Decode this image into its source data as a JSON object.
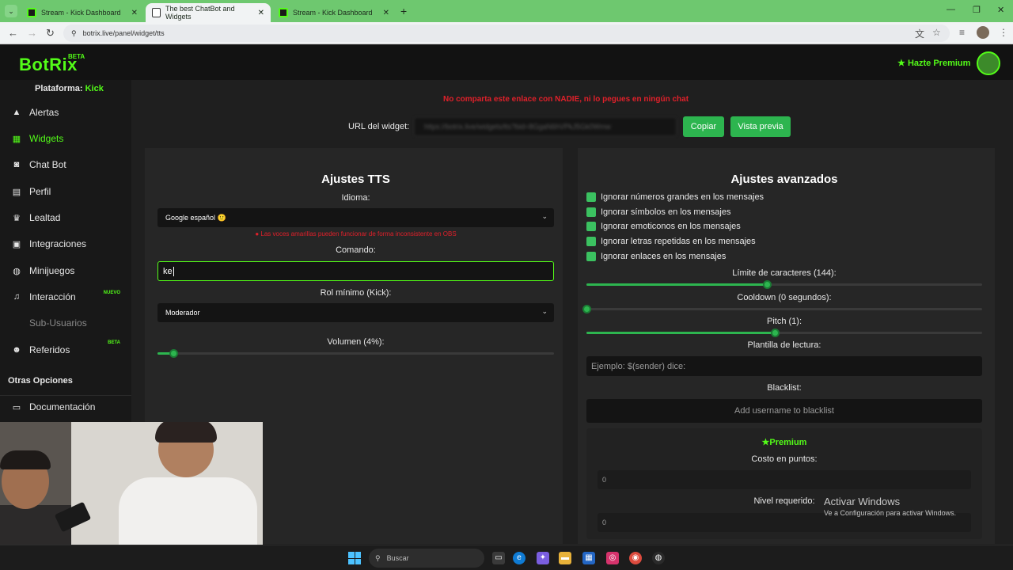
{
  "browser": {
    "tabs": [
      {
        "title": "Stream - Kick Dashboard",
        "active": false
      },
      {
        "title": "The best ChatBot and Widgets",
        "active": true
      },
      {
        "title": "Stream - Kick Dashboard",
        "active": false
      }
    ],
    "url": "botrix.live/panel/widget/tts"
  },
  "header": {
    "logo": "BotRix",
    "logo_badge": "BETA",
    "premium_link": "Hazte Premium"
  },
  "sidebar": {
    "platform_label": "Plataforma:",
    "platform_value": "Kick",
    "items": [
      {
        "label": "Alertas",
        "icon": "warning-icon"
      },
      {
        "label": "Widgets",
        "icon": "grid-icon",
        "active": true
      },
      {
        "label": "Chat Bot",
        "icon": "robot-icon"
      },
      {
        "label": "Perfil",
        "icon": "id-card-icon"
      },
      {
        "label": "Lealtad",
        "icon": "trophy-icon"
      },
      {
        "label": "Integraciones",
        "icon": "plug-icon"
      },
      {
        "label": "Minijuegos",
        "icon": "gamepad-icon"
      },
      {
        "label": "Interacción",
        "icon": "music-icon",
        "badge": "NUEVO"
      },
      {
        "label": "Sub-Usuarios",
        "icon": "users-icon",
        "disabled": true
      },
      {
        "label": "Referidos",
        "icon": "user-group-icon",
        "badge": "BETA"
      }
    ],
    "other_title": "Otras Opciones",
    "docs_label": "Documentación"
  },
  "widget": {
    "warning": "No comparta este enlace con NADIE, ni lo pegues en ningún chat",
    "url_label": "URL del widget:",
    "url_value": "https://botrix.live/widgets/tts?bid=8GgaN6hVPkJ5Gk0Wmw",
    "copy_button": "Copiar",
    "preview_button": "Vista previa"
  },
  "tts": {
    "title": "Ajustes TTS",
    "language_label": "Idioma:",
    "language_value": "Google español 🙂",
    "voice_warning": "Las voces amarillas pueden funcionar de forma inconsistente en OBS",
    "command_label": "Comando:",
    "command_value": "ke",
    "role_label": "Rol mínimo (Kick):",
    "role_value": "Moderador",
    "volume_label": "Volumen (4%):",
    "volume_fraction": 0.04
  },
  "advanced": {
    "title": "Ajustes avanzados",
    "checks": [
      "Ignorar números grandes en los mensajes",
      "Ignorar símbolos en los mensajes",
      "Ignorar emoticonos en los mensajes",
      "Ignorar letras repetidas en los mensajes",
      "Ignorar enlaces en los mensajes"
    ],
    "char_limit_label": "Límite de caracteres (144):",
    "char_limit_fraction": 0.455,
    "cooldown_label": "Cooldown (0 segundos):",
    "cooldown_fraction": 0,
    "pitch_label": "Pitch (1):",
    "pitch_fraction": 0.475,
    "template_label": "Plantilla de lectura:",
    "template_placeholder": "Ejemplo: $(sender) dice:",
    "blacklist_label": "Blacklist:",
    "blacklist_placeholder": "Add username to blacklist",
    "premium_title": "Premium",
    "cost_label": "Costo en puntos:",
    "cost_value": "0",
    "level_label": "Nivel requerido:",
    "level_value": "0"
  },
  "windows": {
    "watermark_title": "Activar Windows",
    "watermark_sub": "Ve a Configuración para activar Windows.",
    "taskbar_search": "Buscar"
  },
  "colors": {
    "brand_green": "#53fc18",
    "button_green": "#2db54f",
    "warning_red": "#e0202a",
    "panel_bg": "#262626"
  }
}
